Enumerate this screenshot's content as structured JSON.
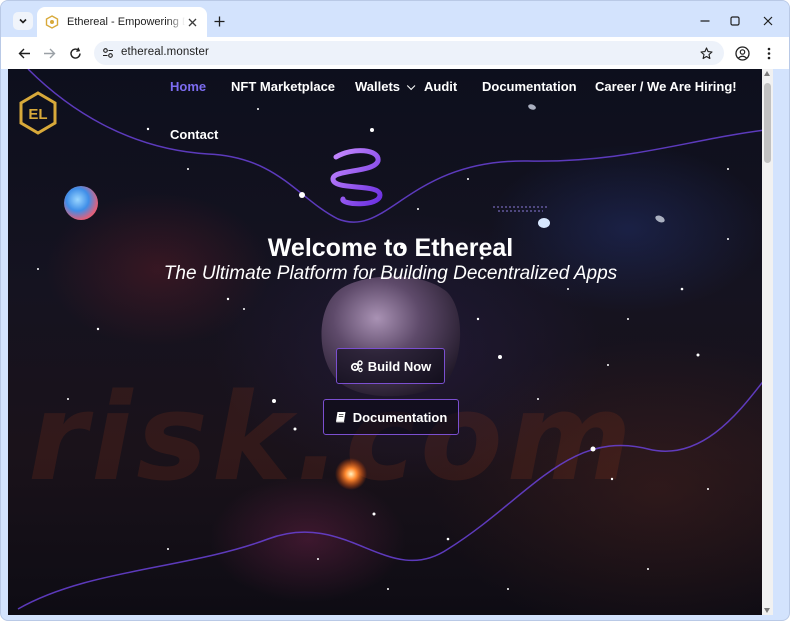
{
  "browser": {
    "tab_title": "Ethereal - Empowering Decentralized Apps",
    "url": "ethereal.monster"
  },
  "page": {
    "logo_text": "EL",
    "nav": [
      {
        "label": "Home",
        "active": true
      },
      {
        "label": "NFT Marketplace",
        "active": false
      },
      {
        "label": "Wallets",
        "active": false,
        "has_dropdown": true
      },
      {
        "label": "Audit",
        "active": false
      },
      {
        "label": "Documentation",
        "active": false
      },
      {
        "label": "Career / We Are Hiring!",
        "active": false
      },
      {
        "label": "Contact",
        "active": false
      }
    ],
    "hero": {
      "title": "Welcome to Ethereal",
      "subtitle": "The Ultimate Platform for Building Decentralized Apps"
    },
    "buttons": {
      "build": {
        "label": "Build Now",
        "icon": "gears-icon"
      },
      "docs": {
        "label": "Documentation",
        "icon": "book-icon"
      }
    },
    "watermark": "risk.com"
  },
  "colors": {
    "accent": "#7c6cf0",
    "button_border": "#7b4fd0",
    "logo_gold": "#d8a93a",
    "chrome_bg": "#d3e3fd"
  }
}
